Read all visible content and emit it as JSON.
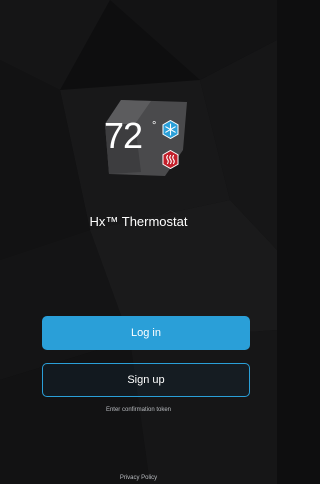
{
  "brand": {
    "temperature": "72",
    "degree_symbol": "°",
    "app_name": "Hx™ Thermostat",
    "mode_icons": [
      "snowflake-icon",
      "heat-wave-icon"
    ]
  },
  "actions": {
    "login_label": "Log in",
    "signup_label": "Sign up",
    "confirmation_label": "Enter confirmation token"
  },
  "footer": {
    "privacy_label": "Privacy Policy"
  },
  "colors": {
    "background": "#0e0e0f",
    "accent_blue": "#2a9fd8",
    "heat_red": "#c2202b",
    "muted_text": "#b9bcc0"
  }
}
